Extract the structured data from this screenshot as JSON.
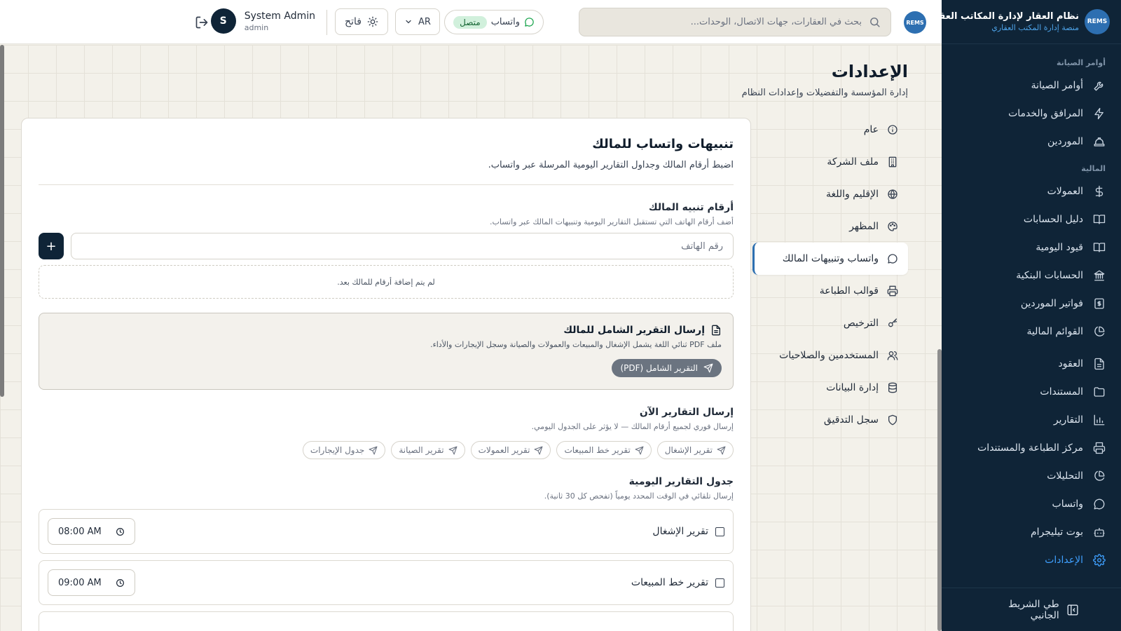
{
  "brand": {
    "logo_text": "REMS",
    "name": "نظام العقار لإدارة المكاتب العقارية",
    "subtitle": "منصة إدارة المكتب العقاري"
  },
  "sidebar": {
    "sections": [
      {
        "label": "أوامر الصيانة",
        "items": [
          {
            "label": "أوامر الصيانة",
            "icon": "wrench-icon"
          },
          {
            "label": "المرافق والخدمات",
            "icon": "zap-icon"
          },
          {
            "label": "الموردين",
            "icon": "hard-hat-icon"
          }
        ]
      },
      {
        "label": "المالية",
        "items": [
          {
            "label": "العمولات",
            "icon": "dollar-icon"
          },
          {
            "label": "دليل الحسابات",
            "icon": "book-icon"
          },
          {
            "label": "قيود اليومية",
            "icon": "book-open-icon"
          },
          {
            "label": "الحسابات البنكية",
            "icon": "bank-icon"
          },
          {
            "label": "فواتير الموردين",
            "icon": "receipt-icon"
          },
          {
            "label": "القوائم المالية",
            "icon": "pie-chart-icon"
          }
        ]
      },
      {
        "label": "",
        "items": [
          {
            "label": "العقود",
            "icon": "file-text-icon"
          },
          {
            "label": "المستندات",
            "icon": "folder-icon"
          },
          {
            "label": "التقارير",
            "icon": "bar-chart-icon"
          },
          {
            "label": "مركز الطباعة والمستندات",
            "icon": "printer-icon"
          },
          {
            "label": "التحليلات",
            "icon": "pie-chart-icon"
          },
          {
            "label": "واتساب",
            "icon": "message-circle-icon"
          },
          {
            "label": "بوت تيليجرام",
            "icon": "bot-icon"
          },
          {
            "label": "الإعدادات",
            "icon": "gear-icon",
            "active": true
          }
        ]
      }
    ],
    "collapse_label": "طي الشريط الجانبي"
  },
  "header": {
    "logo_text": "REMS",
    "search_placeholder": "بحث في العقارات، جهات الاتصال، الوحدات...",
    "whatsapp_label": "واتساب",
    "whatsapp_status": "متصل",
    "language": "AR",
    "theme_label": "فاتح",
    "user_name": "System Admin",
    "user_role": "admin",
    "user_initial": "S"
  },
  "page": {
    "title": "الإعدادات",
    "subtitle": "إدارة المؤسسة والتفضيلات وإعدادات النظام"
  },
  "settings_nav": [
    {
      "label": "عام",
      "icon": "info-icon"
    },
    {
      "label": "ملف الشركة",
      "icon": "building-icon"
    },
    {
      "label": "الإقليم واللغة",
      "icon": "globe-icon"
    },
    {
      "label": "المظهر",
      "icon": "palette-icon"
    },
    {
      "label": "واتساب وتنبيهات المالك",
      "icon": "message-circle-icon",
      "active": true
    },
    {
      "label": "قوالب الطباعة",
      "icon": "printer-icon"
    },
    {
      "label": "الترخيص",
      "icon": "key-icon"
    },
    {
      "label": "المستخدمين والصلاحيات",
      "icon": "users-icon"
    },
    {
      "label": "إدارة البيانات",
      "icon": "database-icon"
    },
    {
      "label": "سجل التدقيق",
      "icon": "shield-icon"
    }
  ],
  "card": {
    "title": "تنبيهات واتساب للمالك",
    "subtitle": "اضبط أرقام المالك وجداول التقارير اليومية المرسلة عبر واتساب.",
    "phones_title": "أرقام تنبيه المالك",
    "phones_help": "أضف أرقام الهاتف التي تستقبل التقارير اليومية وتنبيهات المالك عبر واتساب.",
    "phone_placeholder": "رقم الهاتف",
    "add_label": "+",
    "empty_text": "لم يتم إضافة أرقام للمالك بعد.",
    "full_report_title": "إرسال التقرير الشامل للمالك",
    "full_report_sub": "ملف PDF ثنائي اللغة يشمل الإشغال والمبيعات والعمولات والصيانة وسجل الإيجارات والأداء.",
    "full_report_btn": "التقرير الشامل (PDF)",
    "send_now_title": "إرسال التقارير الآن",
    "send_now_help": "إرسال فوري لجميع أرقام المالك — لا يؤثر على الجدول اليومي.",
    "send_now_chips": [
      "تقرير الإشغال",
      "تقرير خط المبيعات",
      "تقرير العمولات",
      "تقرير الصيانة",
      "جدول الإيجارات"
    ],
    "schedule_title": "جدول التقارير اليومية",
    "schedule_help": "إرسال تلقائي في الوقت المحدد يومياً (تفحص كل 30 ثانية).",
    "schedule": [
      {
        "label": "تقرير الإشغال",
        "time": "08:00 AM",
        "checked": false
      },
      {
        "label": "تقرير خط المبيعات",
        "time": "09:00 AM",
        "checked": false
      }
    ]
  },
  "colors": {
    "sidebar_bg": "#0f2437",
    "accent": "#3fa0ff",
    "status_green": "#16a34a"
  }
}
